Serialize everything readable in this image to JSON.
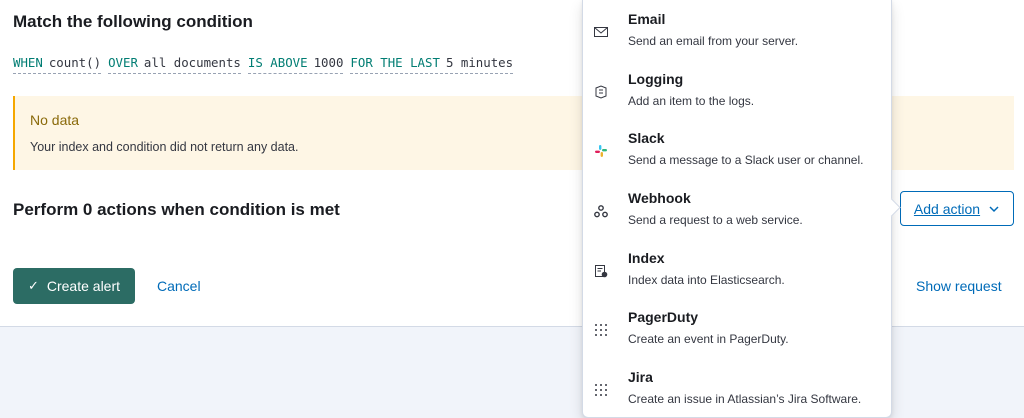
{
  "condition": {
    "title": "Match the following condition",
    "when": "WHEN",
    "agg": "count()",
    "over": "OVER",
    "over_value": "all documents",
    "threshold_comparator": "IS ABOVE",
    "threshold_value": "1000",
    "for_the_last": "FOR THE LAST",
    "window_value": "5 minutes"
  },
  "callout": {
    "title": "No data",
    "body": "Your index and condition did not return any data."
  },
  "actions": {
    "title": "Perform 0 actions when condition is met",
    "add_label": "Add action"
  },
  "footer": {
    "create_label": "Create alert",
    "cancel_label": "Cancel",
    "show_request_label": "Show request"
  },
  "menu": {
    "items": [
      {
        "name": "Email",
        "description": "Send an email from your server.",
        "icon": "mail-icon"
      },
      {
        "name": "Logging",
        "description": "Add an item to the logs.",
        "icon": "logging-icon"
      },
      {
        "name": "Slack",
        "description": "Send a message to a Slack user or channel.",
        "icon": "slack-icon"
      },
      {
        "name": "Webhook",
        "description": "Send a request to a web service.",
        "icon": "webhook-icon"
      },
      {
        "name": "Index",
        "description": "Index data into Elasticsearch.",
        "icon": "index-icon"
      },
      {
        "name": "PagerDuty",
        "description": "Create an event in PagerDuty.",
        "icon": "grid-icon"
      },
      {
        "name": "Jira",
        "description": "Create an issue in Atlassian’s Jira Software.",
        "icon": "grid-icon"
      }
    ]
  },
  "colors": {
    "primary_button": "#2c6c64",
    "link": "#006bb8",
    "keyword": "#017d73",
    "warning_bg": "#fef6e5",
    "warning_text": "#8a6a0a"
  }
}
